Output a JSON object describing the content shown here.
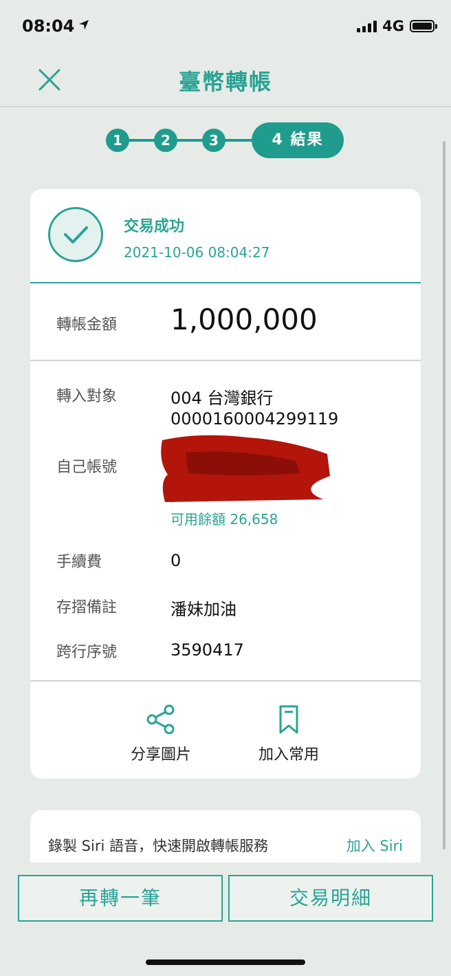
{
  "status_bar": {
    "time": "08:04",
    "network": "4G"
  },
  "nav": {
    "title": "臺幣轉帳"
  },
  "stepper": {
    "steps": [
      "1",
      "2",
      "3"
    ],
    "active_label": "4 結果"
  },
  "result": {
    "title": "交易成功",
    "datetime": "2021-10-06 08:04:27",
    "amount_label": "轉帳金額",
    "amount": "1,000,000",
    "recipient_label": "轉入對象",
    "recipient_bank": "004 台灣銀行",
    "recipient_account": "0000160004299119",
    "own_account_label": "自己帳號",
    "available_balance": "可用餘額 26,658",
    "fee_label": "手續費",
    "fee": "0",
    "memo_label": "存摺備註",
    "memo": "潘妹加油",
    "interbank_label": "跨行序號",
    "interbank_no": "3590417"
  },
  "actions": {
    "share_label": "分享圖片",
    "favorite_label": "加入常用"
  },
  "siri": {
    "text": "錄製 Siri 語音，快速開啟轉帳服務",
    "link": "加入 Siri"
  },
  "buttons": {
    "again": "再轉一筆",
    "details": "交易明細"
  },
  "colors": {
    "accent": "#2aa395",
    "background": "#e6ebe7",
    "redaction": "#b3150b"
  }
}
